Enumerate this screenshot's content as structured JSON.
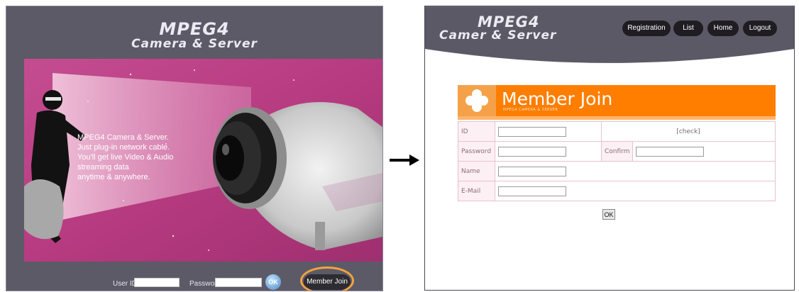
{
  "left_screen": {
    "logo": {
      "line1": "MPEG4",
      "line2": "Camera & Server"
    },
    "hero_text": [
      "MPEG4 Camera & Server.",
      "Just plug-in network cable.",
      "You'll get live Video & Audio",
      "streaming  data",
      "anytime & anywhere."
    ],
    "login": {
      "user_id_label": "User ID",
      "user_id_value": "",
      "password_label": "Password",
      "password_value": "",
      "ok_label": "OK",
      "member_join_label": "Member Join"
    },
    "highlight_color": "#f3a33c"
  },
  "right_screen": {
    "logo": {
      "line1": "MPEG4",
      "line2": "Camer & Server"
    },
    "nav": [
      "Registration",
      "List",
      "Home",
      "Logout"
    ],
    "banner": {
      "title": "Member Join",
      "subtitle": "MPEG4 CAMERA & SERVER"
    },
    "form": {
      "id_label": "ID",
      "check_link": "[check]",
      "password_label": "Password",
      "confirm_label": "Confirm",
      "name_label": "Name",
      "email_label": "E-Mail",
      "submit_label": "OK"
    },
    "accent_color": "#ff7e00"
  }
}
